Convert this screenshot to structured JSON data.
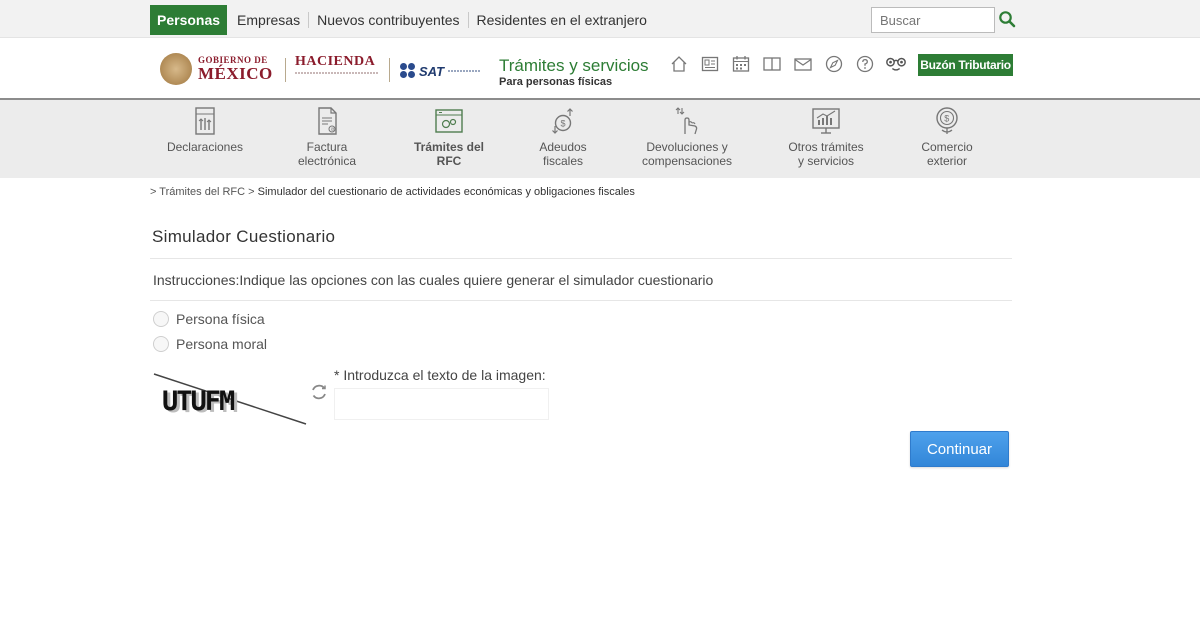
{
  "topbar": {
    "nav": [
      "Personas",
      "Empresas",
      "Nuevos contribuyentes",
      "Residentes en el extranjero"
    ],
    "active": "Personas",
    "search_placeholder": "Buscar"
  },
  "header": {
    "gob_small": "GOBIERNO DE",
    "gob_big": "MÉXICO",
    "hacienda": "HACIENDA",
    "sat": "SAT",
    "title": "Trámites y servicios",
    "subtitle": "Para personas físicas",
    "icons": [
      "home-icon",
      "news-icon",
      "calendar-icon",
      "book-icon",
      "mail-icon",
      "compass-icon",
      "help-icon",
      "accessibility-icon"
    ],
    "buzon": "Buzón Tributario"
  },
  "categories": [
    {
      "label": "Declaraciones",
      "icon": "declaraciones-icon"
    },
    {
      "label": "Factura\nelectrónica",
      "icon": "factura-icon"
    },
    {
      "label": "Trámites del\nRFC",
      "icon": "rfc-icon"
    },
    {
      "label": "Adeudos\nfiscales",
      "icon": "adeudos-icon"
    },
    {
      "label": "Devoluciones y\ncompensaciones",
      "icon": "devoluciones-icon"
    },
    {
      "label": "Otros trámites\ny servicios",
      "icon": "otros-icon"
    },
    {
      "label": "Comercio\nexterior",
      "icon": "comercio-icon"
    }
  ],
  "active_category": "Trámites del\nRFC",
  "breadcrumb": {
    "sep1": ">",
    "link": "Trámites del RFC",
    "sep2": ">",
    "current": "Simulador del cuestionario de actividades económicas y obligaciones fiscales"
  },
  "main": {
    "title": "Simulador Cuestionario",
    "instructions": "Instrucciones:Indique las opciones con las cuales quiere generar el simulador cuestionario",
    "options": [
      "Persona física",
      "Persona moral"
    ],
    "captcha_text": "UTUFM",
    "captcha_label": "* Introduzca el texto de la imagen:",
    "captcha_value": "",
    "continue_label": "Continuar"
  },
  "colors": {
    "green": "#2d7d35",
    "blue": "#3286d8",
    "maroon": "#8b1c2c"
  }
}
